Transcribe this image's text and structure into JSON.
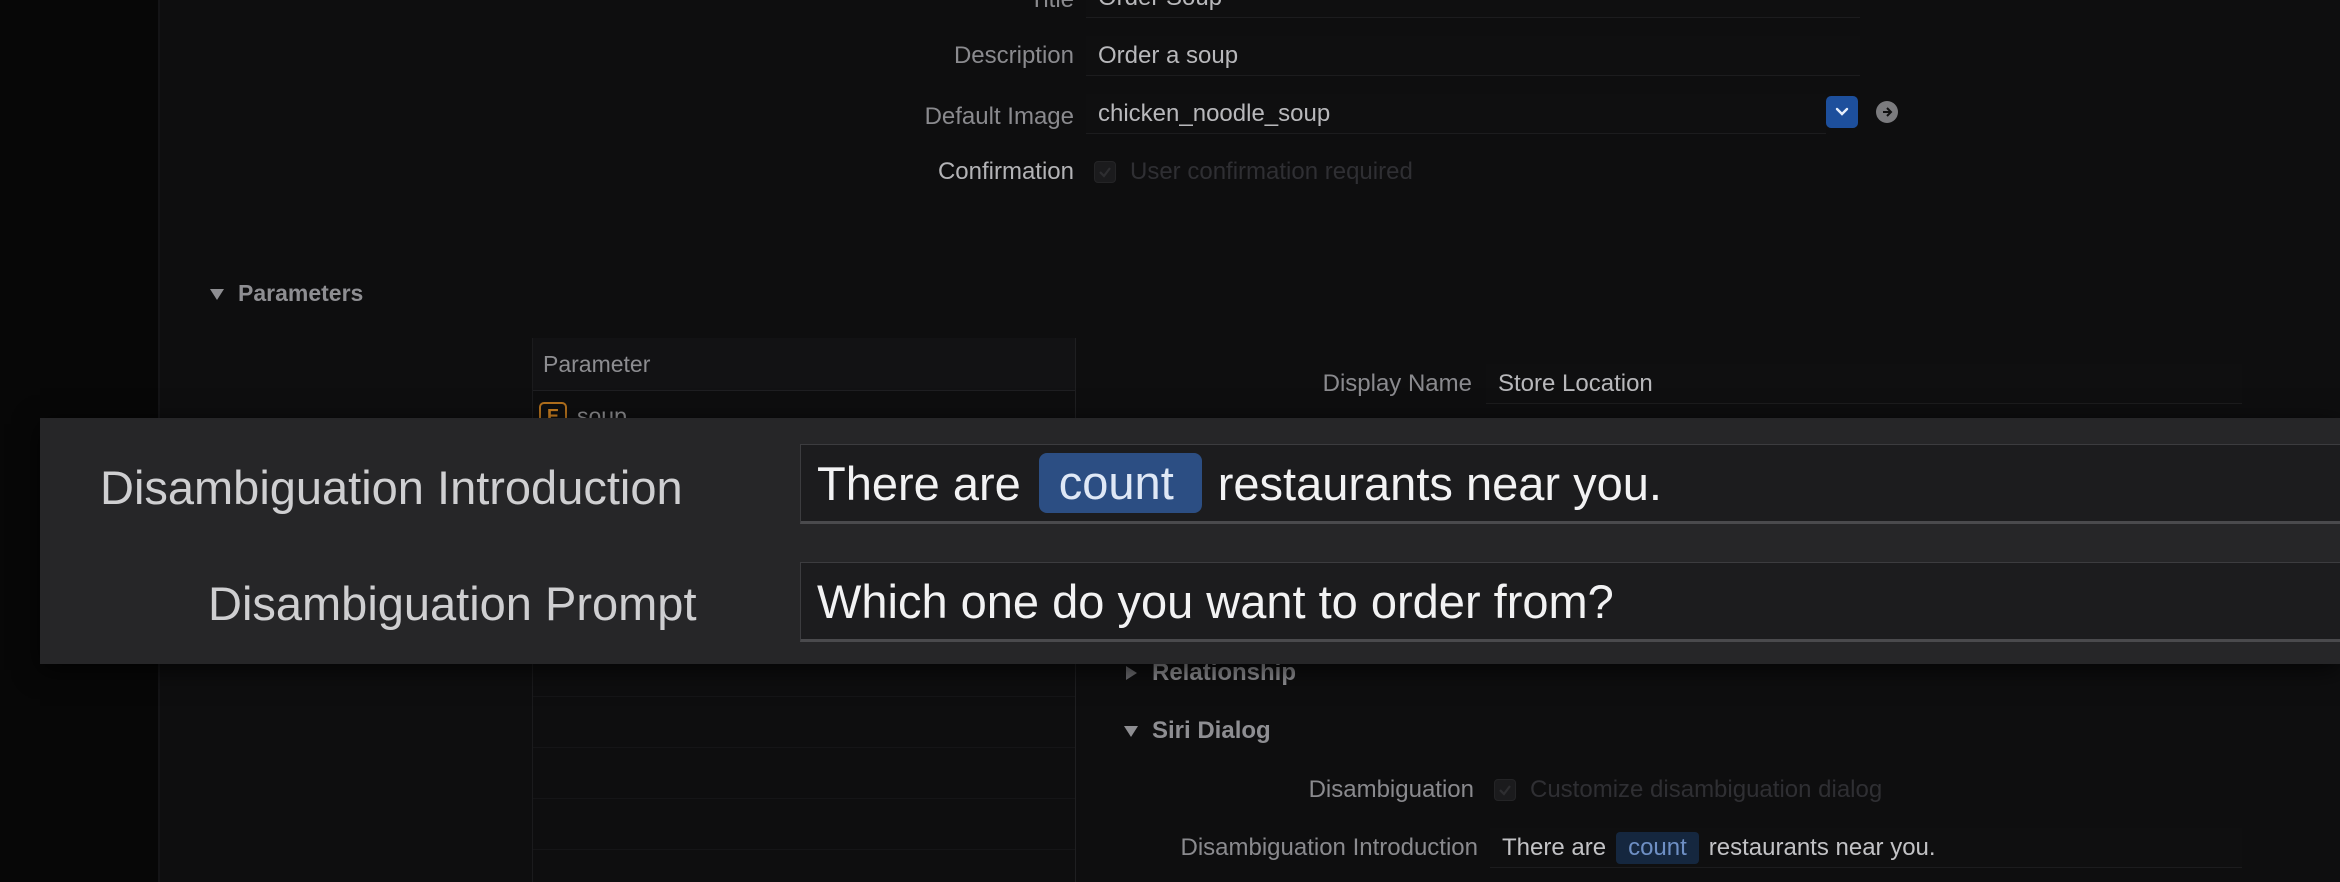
{
  "general": {
    "title_label": "Title",
    "title_value": "Order Soup",
    "description_label": "Description",
    "description_value": "Order a soup",
    "default_image_label": "Default Image",
    "default_image_value": "chicken_noodle_soup",
    "confirmation_label": "Confirmation",
    "confirmation_text": "User confirmation required"
  },
  "parameters": {
    "header": "Parameters",
    "table_header": "Parameter",
    "items": [
      {
        "badge": "E",
        "name": "soup"
      }
    ]
  },
  "detail": {
    "display_name_label": "Display Name",
    "display_name_value": "Store Location",
    "relationship_header": "Relationship",
    "siri_dialog_header": "Siri Dialog",
    "disambiguation_label": "Disambiguation",
    "disambiguation_checkbox_text": "Customize disambiguation dialog",
    "disambiguation_intro_label": "Disambiguation Introduction",
    "disambiguation_intro_before": "There are",
    "disambiguation_intro_token": "count",
    "disambiguation_intro_after": "restaurants near you."
  },
  "overlay": {
    "intro_label": "Disambiguation Introduction",
    "intro_before": "There are",
    "intro_token": "count",
    "intro_after": "restaurants near you.",
    "prompt_label": "Disambiguation Prompt",
    "prompt_value": "Which one do you want to order from?"
  },
  "colors": {
    "token_bg": "#2c4e83",
    "popup_accent": "#1d4f9c",
    "enum_badge": "#c77d1f"
  }
}
